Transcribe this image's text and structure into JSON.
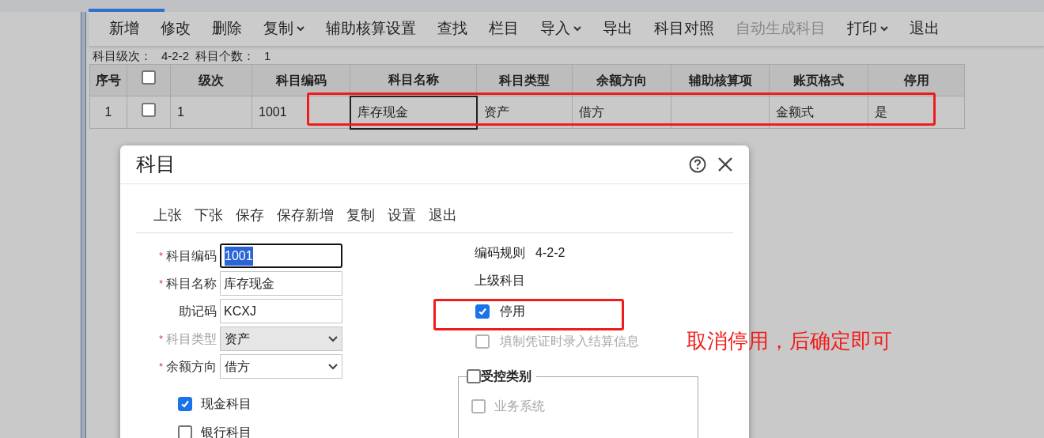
{
  "toolbar": [
    {
      "label": "新增",
      "dropdown": false,
      "disabled": false
    },
    {
      "label": "修改",
      "dropdown": false,
      "disabled": false
    },
    {
      "label": "删除",
      "dropdown": false,
      "disabled": false
    },
    {
      "label": "复制",
      "dropdown": true,
      "disabled": false
    },
    {
      "label": "辅助核算设置",
      "dropdown": false,
      "disabled": false
    },
    {
      "label": "查找",
      "dropdown": false,
      "disabled": false
    },
    {
      "label": "栏目",
      "dropdown": false,
      "disabled": false
    },
    {
      "label": "导入",
      "dropdown": true,
      "disabled": false
    },
    {
      "label": "导出",
      "dropdown": false,
      "disabled": false
    },
    {
      "label": "科目对照",
      "dropdown": false,
      "disabled": false
    },
    {
      "label": "自动生成科目",
      "dropdown": false,
      "disabled": true
    },
    {
      "label": "打印",
      "dropdown": true,
      "disabled": false
    },
    {
      "label": "退出",
      "dropdown": false,
      "disabled": false
    }
  ],
  "summary": [
    {
      "label": "科目级次：",
      "value": "4-2-2"
    },
    {
      "label": "科目个数：",
      "value": "1"
    }
  ],
  "table": {
    "columns": [
      {
        "kind": "text",
        "label": "序号"
      },
      {
        "kind": "checkbox",
        "checked": false
      },
      {
        "kind": "text",
        "label": "级次"
      },
      {
        "kind": "text",
        "label": "科目编码"
      },
      {
        "kind": "text",
        "label": "科目名称"
      },
      {
        "kind": "text",
        "label": "科目类型"
      },
      {
        "kind": "text",
        "label": "余额方向"
      },
      {
        "kind": "text",
        "label": "辅助核算项"
      },
      {
        "kind": "text",
        "label": "账页格式"
      },
      {
        "kind": "text",
        "label": "停用"
      }
    ],
    "rows": [
      {
        "cells": [
          {
            "kind": "text",
            "text": "1",
            "focused": false
          },
          {
            "kind": "checkbox",
            "checked": false
          },
          {
            "kind": "text",
            "text": "1",
            "focused": false
          },
          {
            "kind": "text",
            "text": "1001",
            "focused": false
          },
          {
            "kind": "text",
            "text": "库存现金",
            "focused": true
          },
          {
            "kind": "text",
            "text": "资产",
            "focused": false
          },
          {
            "kind": "text",
            "text": "借方",
            "focused": false
          },
          {
            "kind": "text",
            "focused": false
          },
          {
            "kind": "text",
            "text": "金额式",
            "focused": false
          },
          {
            "kind": "text",
            "text": "是",
            "focused": false
          }
        ]
      }
    ]
  },
  "dialog": {
    "title": "科目",
    "toolbar": [
      "上张",
      "下张",
      "保存",
      "保存新增",
      "复制",
      "设置",
      "退出"
    ],
    "fields": [
      {
        "marker": "*",
        "label": "科目编码",
        "kind": "text",
        "value": "1001",
        "focused": true
      },
      {
        "marker": "*",
        "label": "科目名称",
        "kind": "text",
        "value": "库存现金",
        "focused": false
      },
      {
        "label": "助记码",
        "kind": "text",
        "value": "KCXJ",
        "focused": false
      },
      {
        "marker": "*",
        "label": "科目类型",
        "kind": "select",
        "value": "资产",
        "disabled": true
      },
      {
        "marker": "*",
        "label": "余额方向",
        "kind": "select",
        "value": "借方",
        "disabled": false
      }
    ],
    "left_checks": [
      {
        "label": "现金科目",
        "checked": true
      },
      {
        "label": "银行科目",
        "checked": false
      }
    ],
    "info": [
      {
        "label": "编码规则",
        "value": "4-2-2"
      },
      {
        "label": "上级科目"
      }
    ],
    "options": [
      {
        "label": "停用",
        "checked": true,
        "disabled": false
      },
      {
        "label": "填制凭证时录入结算信息",
        "checked": false,
        "disabled": true
      }
    ],
    "group": {
      "label": "受控类别",
      "checked": false,
      "items": [
        {
          "label": "业务系统",
          "checked": false,
          "disabled": true
        }
      ]
    }
  },
  "annotation": {
    "text": "取消停用，后确定即可"
  }
}
